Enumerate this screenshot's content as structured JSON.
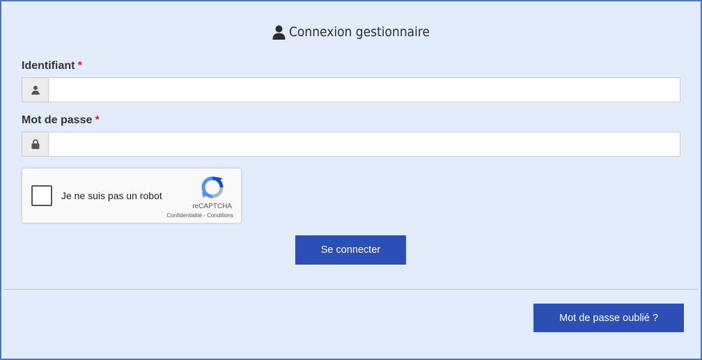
{
  "header": {
    "title": "Connexion gestionnaire",
    "icon": "user-icon"
  },
  "form": {
    "username": {
      "label": "Identifiant",
      "required_mark": "*",
      "value": "",
      "placeholder": "",
      "icon": "user-icon"
    },
    "password": {
      "label": "Mot de passe",
      "required_mark": "*",
      "value": "",
      "placeholder": "",
      "icon": "lock-icon"
    },
    "captcha": {
      "label": "Je ne suis pas un robot",
      "brand": "reCAPTCHA",
      "privacy": "Confidentialité",
      "separator": "-",
      "terms": "Conditions",
      "checked": false
    },
    "submit_label": "Se connecter"
  },
  "footer": {
    "forgot_label": "Mot de passe oublié ?"
  },
  "colors": {
    "background": "#e3ecfb",
    "border": "#4a74c9",
    "button": "#2c4fb5",
    "required": "#e02020"
  }
}
